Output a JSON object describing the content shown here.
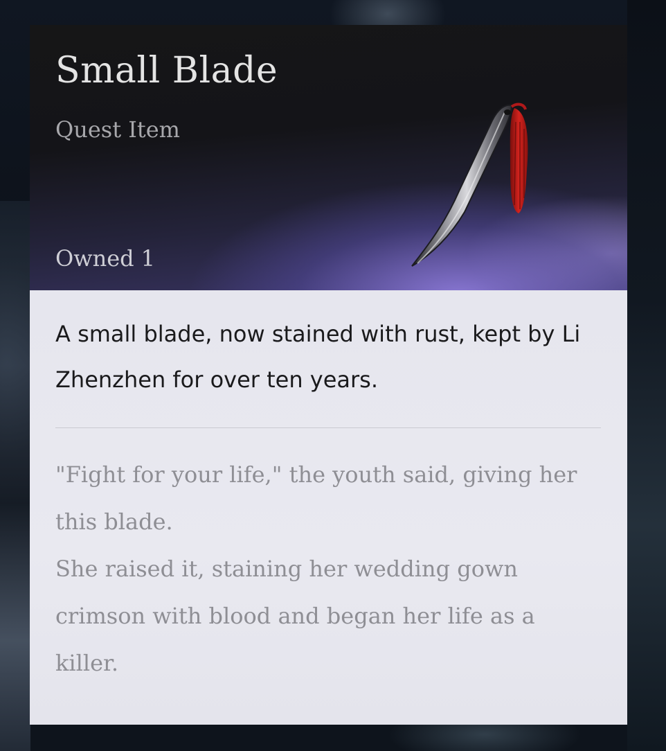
{
  "item": {
    "name": "Small Blade",
    "category": "Quest Item",
    "owned_label": "Owned",
    "owned_count": "1",
    "icon": "blade-with-red-tassel-icon",
    "description": "A small blade, now stained with rust, kept by Li Zhenzhen for over ten years.",
    "lore": [
      "\"Fight for your life,\" the youth said, giving her this blade.",
      "She raised it, staining her wedding gown crimson with blood and began her life as a killer."
    ]
  },
  "colors": {
    "header_bg": "#161617",
    "header_glow": "#8c7de0",
    "body_bg": "#e7e7ee",
    "title": "#e4e4e4",
    "category": "#a8a8ac",
    "description": "#1a1a1c",
    "lore": "#8e8e94",
    "tassel": "#c8201c"
  }
}
